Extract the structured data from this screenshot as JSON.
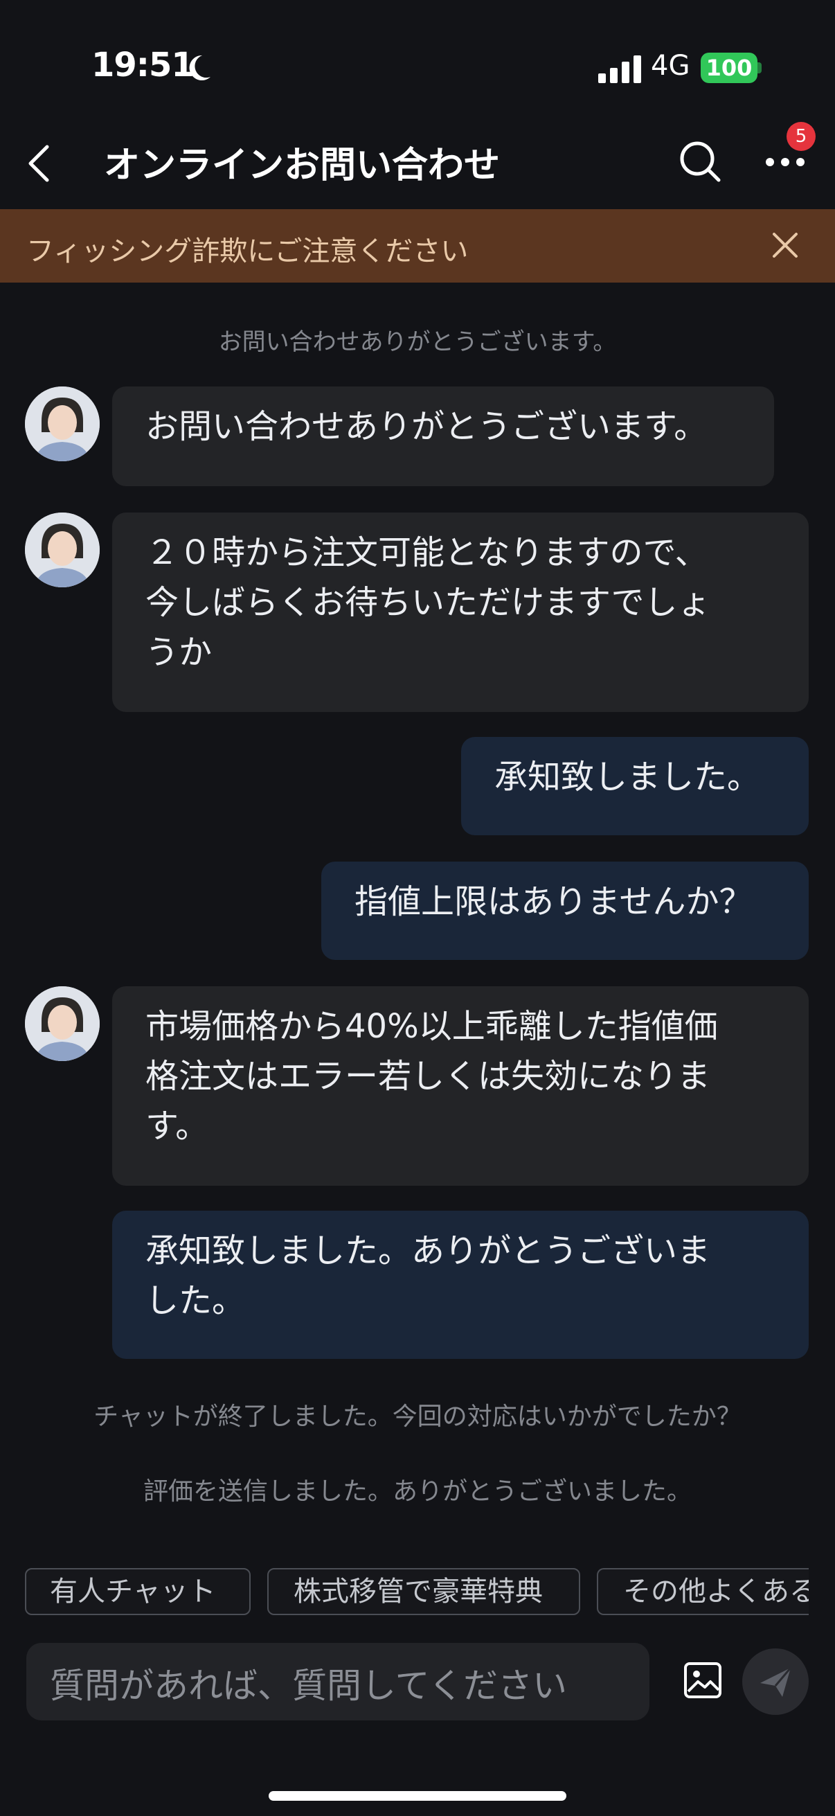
{
  "status_bar": {
    "time": "19:51",
    "network": "4G",
    "battery": "100"
  },
  "header": {
    "title": "オンラインお問い合わせ",
    "badge_count": "5"
  },
  "banner": {
    "text": "フィッシング詐欺にご注意ください"
  },
  "system_messages": {
    "top": "お問い合わせありがとうございます。",
    "chat_ended": "チャットが終了しました。今回の対応はいかがでしたか？",
    "rating_sent": "評価を送信しました。ありがとうございました。"
  },
  "messages": [
    {
      "from": "agent",
      "line1": "お問い合わせありがとうございます。"
    },
    {
      "from": "agent",
      "line1": "２０時から注文可能となりますので、",
      "line2": "今しばらくお待ちいただけますでしょ",
      "line3": "うか"
    },
    {
      "from": "user",
      "line1": "承知致しました。"
    },
    {
      "from": "user",
      "line1": "指値上限はありませんか？"
    },
    {
      "from": "agent",
      "line1": "市場価格から40%以上乖離した指値価",
      "line2": "格注文はエラー若しくは失効になりま",
      "line3": "す。"
    },
    {
      "from": "user",
      "line1": "承知致しました。ありがとうございま",
      "line2": "した。"
    }
  ],
  "quick_replies": [
    "有人チャット",
    "株式移管で豪華特典",
    "その他よくある"
  ],
  "input": {
    "placeholder": "質問があれば、質問してください"
  },
  "colors": {
    "background": "#121317",
    "banner": "#5b3620",
    "agent_bubble": "#232427",
    "user_bubble": "#1a2639",
    "badge": "#e5343d",
    "battery": "#31c759"
  }
}
